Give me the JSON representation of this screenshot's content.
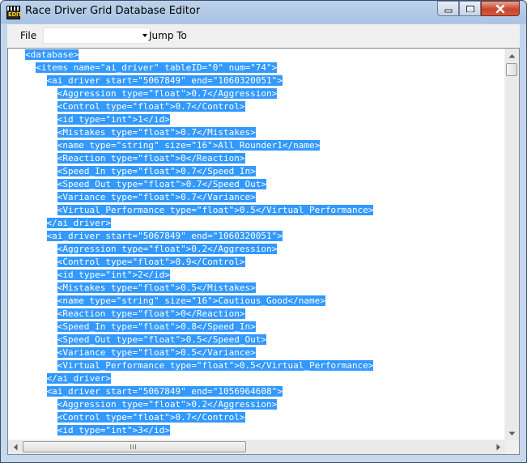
{
  "window": {
    "title": "Race Driver Grid Database Editor",
    "app_icon_text": "EDIT"
  },
  "menubar": {
    "file_label": "File",
    "jump_label": "Jump To",
    "jump_select_value": ""
  },
  "editor": {
    "lines": [
      "<database>",
      "  <items name=\"ai_driver\" tableID=\"0\" num=\"74\">",
      "    <ai_driver start=\"5067849\" end=\"1060320051\">",
      "      <Aggression type=\"float\">0.7</Aggression>",
      "      <Control type=\"float\">0.7</Control>",
      "      <id type=\"int\">1</id>",
      "      <Mistakes type=\"float\">0.7</Mistakes>",
      "      <name type=\"string\" size=\"16\">All_Rounder1</name>",
      "      <Reaction type=\"float\">0</Reaction>",
      "      <Speed_In type=\"float\">0.7</Speed_In>",
      "      <Speed_Out type=\"float\">0.7</Speed_Out>",
      "      <Variance type=\"float\">0.7</Variance>",
      "      <Virtual_Performance type=\"float\">0.5</Virtual_Performance>",
      "    </ai_driver>",
      "    <ai_driver start=\"5067849\" end=\"1060320051\">",
      "      <Aggression type=\"float\">0.2</Aggression>",
      "      <Control type=\"float\">0.9</Control>",
      "      <id type=\"int\">2</id>",
      "      <Mistakes type=\"float\">0.5</Mistakes>",
      "      <name type=\"string\" size=\"16\">Cautious_Good</name>",
      "      <Reaction type=\"float\">0</Reaction>",
      "      <Speed_In type=\"float\">0.8</Speed_In>",
      "      <Speed_Out type=\"float\">0.5</Speed_Out>",
      "      <Variance type=\"float\">0.5</Variance>",
      "      <Virtual_Performance type=\"float\">0.5</Virtual_Performance>",
      "    </ai_driver>",
      "    <ai_driver start=\"5067849\" end=\"1056964608\">",
      "      <Aggression type=\"float\">0.2</Aggression>",
      "      <Control type=\"float\">0.7</Control>",
      "      <id type=\"int\">3</id>"
    ],
    "selection_color": "#3399ff"
  },
  "icons": {
    "minimize": "minimize-icon",
    "maximize": "maximize-icon",
    "close": "close-icon"
  }
}
